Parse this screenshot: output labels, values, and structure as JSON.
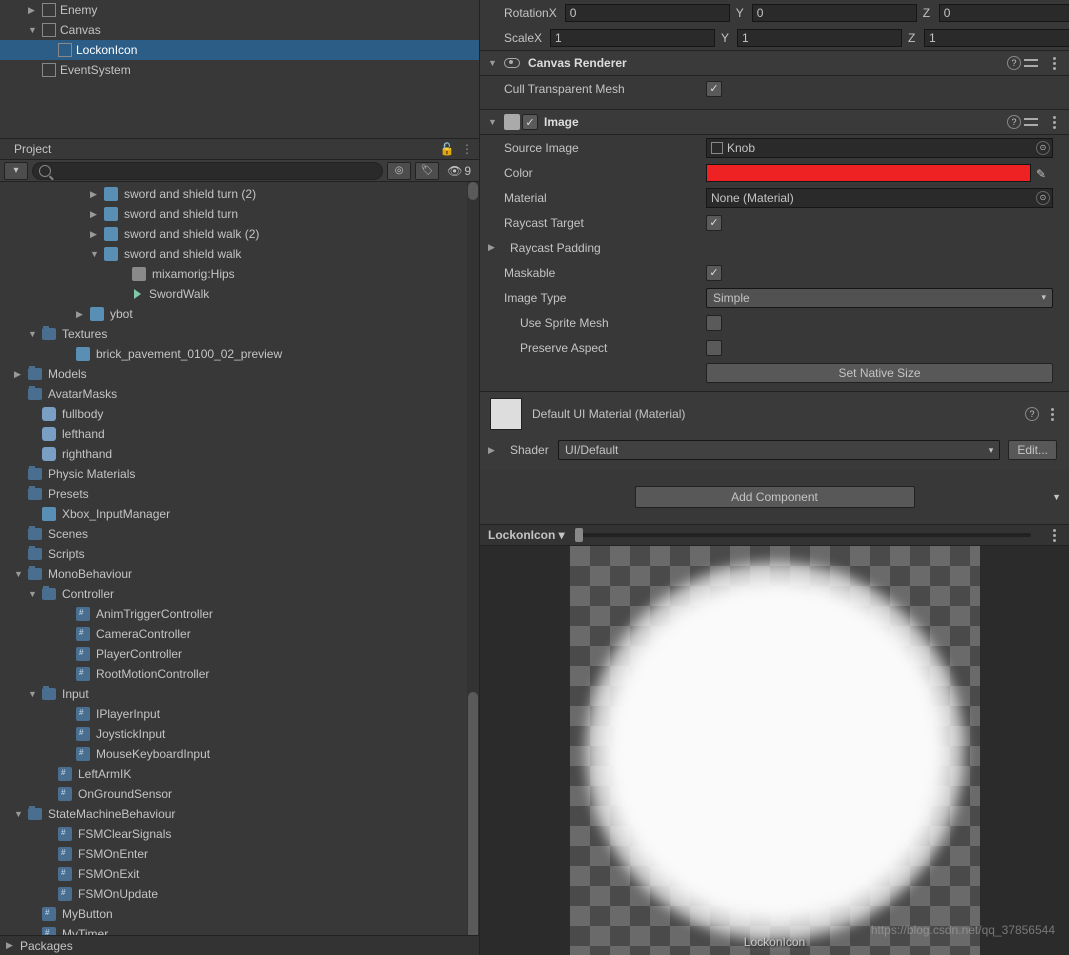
{
  "hierarchy": {
    "items": [
      {
        "label": "Enemy",
        "indent": 2,
        "arrow": "▶",
        "selected": false
      },
      {
        "label": "Canvas",
        "indent": 2,
        "arrow": "▼",
        "selected": false
      },
      {
        "label": "LockonIcon",
        "indent": 3,
        "arrow": "",
        "selected": true
      },
      {
        "label": "EventSystem",
        "indent": 2,
        "arrow": "",
        "selected": false
      }
    ]
  },
  "projectPanel": {
    "tabLabel": "Project",
    "visibilityCount": "9",
    "tree": [
      {
        "label": "sword and shield turn (2)",
        "indent": 90,
        "arrow": "▶",
        "icon": "model"
      },
      {
        "label": "sword and shield turn",
        "indent": 90,
        "arrow": "▶",
        "icon": "model"
      },
      {
        "label": "sword and shield walk (2)",
        "indent": 90,
        "arrow": "▶",
        "icon": "model"
      },
      {
        "label": "sword and shield walk",
        "indent": 90,
        "arrow": "▼",
        "icon": "model"
      },
      {
        "label": "mixamorig:Hips",
        "indent": 118,
        "arrow": "",
        "icon": "bone"
      },
      {
        "label": "SwordWalk",
        "indent": 118,
        "arrow": "",
        "icon": "anim"
      },
      {
        "label": "ybot",
        "indent": 76,
        "arrow": "▶",
        "icon": "model"
      },
      {
        "label": "Textures",
        "indent": 28,
        "arrow": "▼",
        "icon": "folder"
      },
      {
        "label": "brick_pavement_0100_02_preview",
        "indent": 62,
        "arrow": "",
        "icon": "file"
      },
      {
        "label": "Models",
        "indent": 14,
        "arrow": "▶",
        "icon": "folder"
      },
      {
        "label": "AvatarMasks",
        "indent": 14,
        "arrow": "",
        "icon": "folder"
      },
      {
        "label": "fullbody",
        "indent": 28,
        "arrow": "",
        "icon": "mask"
      },
      {
        "label": "lefthand",
        "indent": 28,
        "arrow": "",
        "icon": "mask"
      },
      {
        "label": "righthand",
        "indent": 28,
        "arrow": "",
        "icon": "mask"
      },
      {
        "label": "Physic Materials",
        "indent": 14,
        "arrow": "",
        "icon": "folder"
      },
      {
        "label": "Presets",
        "indent": 14,
        "arrow": "",
        "icon": "folder"
      },
      {
        "label": "Xbox_InputManager",
        "indent": 28,
        "arrow": "",
        "icon": "file"
      },
      {
        "label": "Scenes",
        "indent": 14,
        "arrow": "",
        "icon": "folder"
      },
      {
        "label": "Scripts",
        "indent": 14,
        "arrow": "",
        "icon": "folder"
      },
      {
        "label": "MonoBehaviour",
        "indent": 14,
        "arrow": "▼",
        "icon": "folder"
      },
      {
        "label": "Controller",
        "indent": 28,
        "arrow": "▼",
        "icon": "folder"
      },
      {
        "label": "AnimTriggerController",
        "indent": 62,
        "arrow": "",
        "icon": "script"
      },
      {
        "label": "CameraController",
        "indent": 62,
        "arrow": "",
        "icon": "script"
      },
      {
        "label": "PlayerController",
        "indent": 62,
        "arrow": "",
        "icon": "script"
      },
      {
        "label": "RootMotionController",
        "indent": 62,
        "arrow": "",
        "icon": "script"
      },
      {
        "label": "Input",
        "indent": 28,
        "arrow": "▼",
        "icon": "folder"
      },
      {
        "label": "IPlayerInput",
        "indent": 62,
        "arrow": "",
        "icon": "script"
      },
      {
        "label": "JoystickInput",
        "indent": 62,
        "arrow": "",
        "icon": "script"
      },
      {
        "label": "MouseKeyboardInput",
        "indent": 62,
        "arrow": "",
        "icon": "script"
      },
      {
        "label": "LeftArmIK",
        "indent": 44,
        "arrow": "",
        "icon": "script"
      },
      {
        "label": "OnGroundSensor",
        "indent": 44,
        "arrow": "",
        "icon": "script"
      },
      {
        "label": "StateMachineBehaviour",
        "indent": 14,
        "arrow": "▼",
        "icon": "folder"
      },
      {
        "label": "FSMClearSignals",
        "indent": 44,
        "arrow": "",
        "icon": "script"
      },
      {
        "label": "FSMOnEnter",
        "indent": 44,
        "arrow": "",
        "icon": "script"
      },
      {
        "label": "FSMOnExit",
        "indent": 44,
        "arrow": "",
        "icon": "script"
      },
      {
        "label": "FSMOnUpdate",
        "indent": 44,
        "arrow": "",
        "icon": "script"
      },
      {
        "label": "MyButton",
        "indent": 28,
        "arrow": "",
        "icon": "script"
      },
      {
        "label": "MyTimer",
        "indent": 28,
        "arrow": "",
        "icon": "script"
      }
    ],
    "packagesLabel": "Packages"
  },
  "inspector": {
    "transform": {
      "rotationLabel": "Rotation",
      "scaleLabel": "Scale",
      "rotX": "0",
      "rotY": "0",
      "rotZ": "0",
      "scaleX": "1",
      "scaleY": "1",
      "scaleZ": "1",
      "xLabel": "X",
      "yLabel": "Y",
      "zLabel": "Z"
    },
    "canvasRenderer": {
      "title": "Canvas Renderer",
      "cullTransparentLabel": "Cull Transparent Mesh",
      "cullTransparentChecked": true
    },
    "image": {
      "title": "Image",
      "enabledChecked": true,
      "sourceImageLabel": "Source Image",
      "sourceImageValue": "Knob",
      "colorLabel": "Color",
      "colorValue": "#e22222",
      "materialLabel": "Material",
      "materialValue": "None (Material)",
      "raycastTargetLabel": "Raycast Target",
      "raycastTargetChecked": true,
      "raycastPaddingLabel": "Raycast Padding",
      "maskableLabel": "Maskable",
      "maskableChecked": true,
      "imageTypeLabel": "Image Type",
      "imageTypeValue": "Simple",
      "useSpriteMeshLabel": "Use Sprite Mesh",
      "useSpriteMeshChecked": false,
      "preserveAspectLabel": "Preserve Aspect",
      "preserveAspectChecked": false,
      "setNativeSizeLabel": "Set Native Size"
    },
    "material": {
      "title": "Default UI Material (Material)",
      "shaderLabel": "Shader",
      "shaderValue": "UI/Default",
      "editLabel": "Edit..."
    },
    "addComponentLabel": "Add Component",
    "preview": {
      "tabLabel": "LockonIcon",
      "objectLabel": "LockonIcon"
    },
    "watermark": "https://blog.csdn.net/qq_37856544"
  }
}
